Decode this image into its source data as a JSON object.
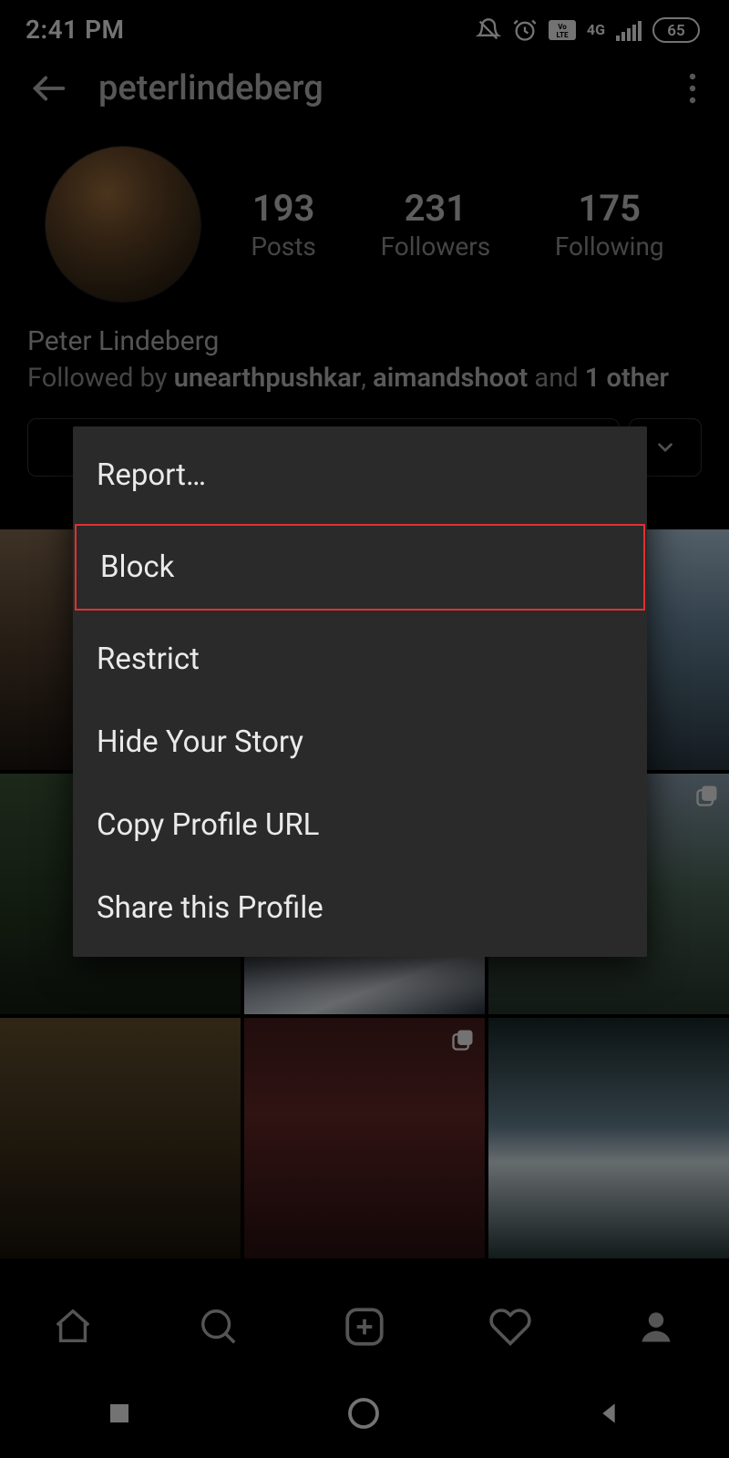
{
  "status": {
    "time": "2:41 PM",
    "battery": "65",
    "network": "4G"
  },
  "header": {
    "username": "peterlindeberg"
  },
  "profile": {
    "display_name": "Peter Lindeberg",
    "stats": {
      "posts": {
        "count": "193",
        "label": "Posts"
      },
      "followers": {
        "count": "231",
        "label": "Followers"
      },
      "following": {
        "count": "175",
        "label": "Following"
      }
    },
    "followed_by": {
      "prefix": "Followed by ",
      "user1": "unearthpushkar",
      "sep1": ", ",
      "user2": "aimandshoot",
      "sep2": " and ",
      "suffix": "1 other"
    }
  },
  "menu": {
    "report": "Report…",
    "block": "Block",
    "restrict": "Restrict",
    "hide_story": "Hide Your Story",
    "copy_url": "Copy Profile URL",
    "share": "Share this Profile"
  }
}
